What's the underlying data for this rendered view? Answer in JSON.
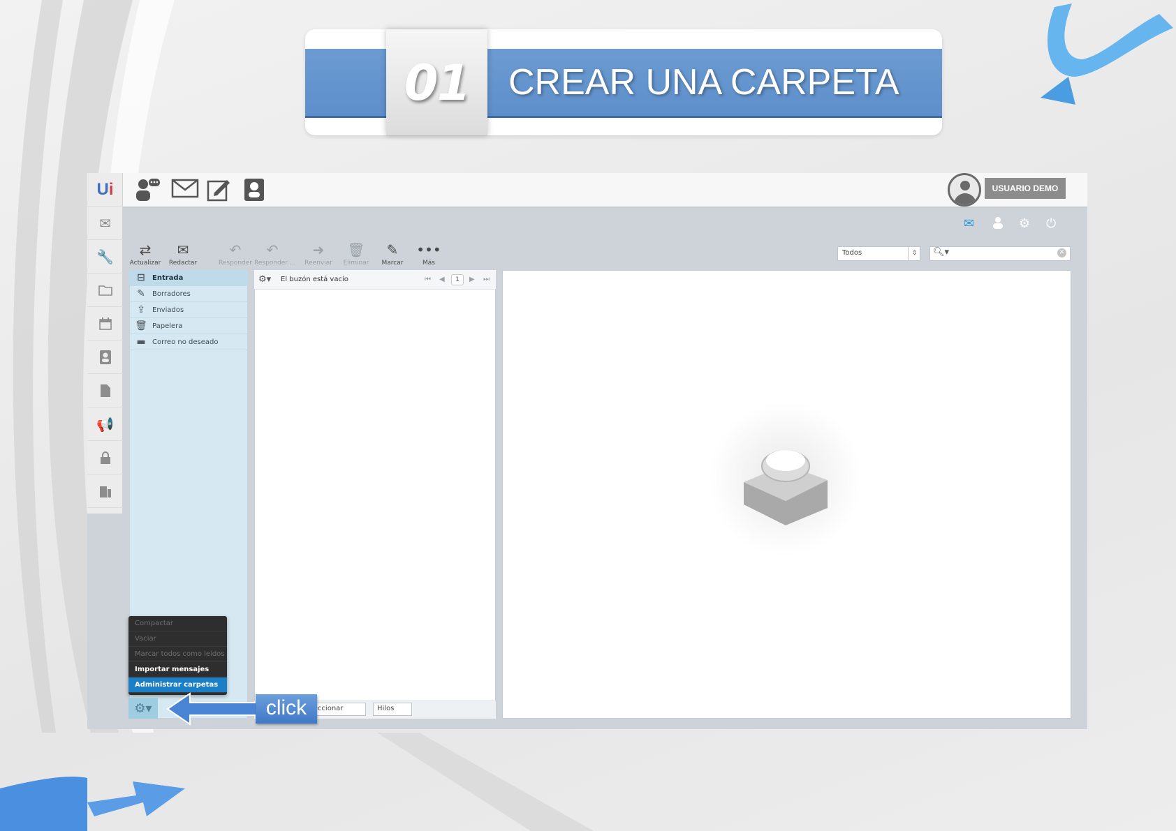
{
  "banner": {
    "number": "01",
    "title": "CREAR UNA CARPETA"
  },
  "topbar": {
    "icons": [
      "users-icon",
      "mail-icon",
      "compose-icon",
      "contacts-icon"
    ],
    "user_label": "USUARIO DEMO"
  },
  "leftnav": {
    "items": [
      "app-logo",
      "mail-icon",
      "wrench-icon",
      "folder-icon",
      "calendar-icon",
      "contacts-icon",
      "document-icon",
      "megaphone-icon",
      "lock-icon",
      "exit-icon"
    ]
  },
  "utility_icons": [
    "mail-icon",
    "user-icon",
    "gear-icon",
    "power-icon"
  ],
  "toolbar": {
    "buttons": [
      {
        "label": "Actualizar",
        "enabled": true
      },
      {
        "label": "Redactar",
        "enabled": true
      },
      {
        "label": "Responder",
        "enabled": false
      },
      {
        "label": "Responder ...",
        "enabled": false
      },
      {
        "label": "Reenviar",
        "enabled": false
      },
      {
        "label": "Eliminar",
        "enabled": false
      },
      {
        "label": "Marcar",
        "enabled": true
      },
      {
        "label": "Más",
        "enabled": true
      }
    ],
    "filter_value": "Todos",
    "search_value": ""
  },
  "folders": [
    {
      "label": "Entrada",
      "icon": "inbox-icon",
      "selected": true
    },
    {
      "label": "Borradores",
      "icon": "pencil-icon"
    },
    {
      "label": "Enviados",
      "icon": "sent-icon"
    },
    {
      "label": "Papelera",
      "icon": "trash-icon"
    },
    {
      "label": "Correo no deseado",
      "icon": "folder-icon"
    }
  ],
  "message_list": {
    "empty_text": "El buzón está vacío",
    "page": "1",
    "footer_select": "leccionar",
    "threads_select": "Hilos"
  },
  "folder_menu": {
    "items": [
      {
        "label": "Compactar",
        "state": "disabled"
      },
      {
        "label": "Vaciar",
        "state": "disabled"
      },
      {
        "label": "Marcar todos como leídos",
        "state": "disabled"
      },
      {
        "label": "Importar mensajes",
        "state": "enabled"
      },
      {
        "label": "Administrar carpetas",
        "state": "active"
      }
    ]
  },
  "callout": {
    "label": "click"
  },
  "colors": {
    "banner_blue": "#6b9bd1",
    "folder_panel": "#d6e9f2",
    "menu_bg": "#2e2e2e",
    "menu_active": "#1a7fc7",
    "callout_blue": "#3f79c7"
  }
}
